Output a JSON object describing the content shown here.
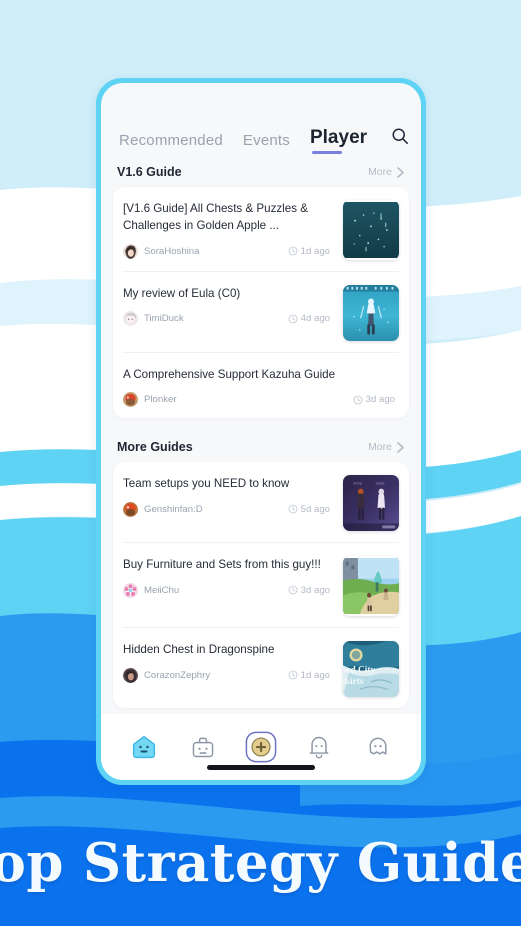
{
  "theme": {
    "page_bg": "#cfeefa",
    "frame_border": "#5fd3f3",
    "screen_bg": "#f7f8fa",
    "card_bg": "#ffffff",
    "accent_underline": "#7b7fe0",
    "banner_bg": "#0b72ee",
    "banner_text_color": "#f4fbff",
    "wave_light": "#ffffff",
    "wave_pale": "#cfeefa",
    "wave_cyan": "#5fd3f3",
    "wave_blue": "#2b9bf0",
    "wave_deep": "#0b72ee"
  },
  "tabs": [
    {
      "label": "Recommended",
      "active": false
    },
    {
      "label": "Events",
      "active": false
    },
    {
      "label": "Player",
      "active": true
    }
  ],
  "search": {
    "icon": "search-icon"
  },
  "sections": [
    {
      "title": "V1.6 Guide",
      "more_label": "More",
      "items": [
        {
          "title": "[V1.6 Guide] All Chests & Puzzles & Challenges in Golden Apple ...",
          "author": "SoraHoshina",
          "time": "1d ago",
          "thumb": "starry-night-chests"
        },
        {
          "title": "My review of Eula (C0)",
          "author": "TimiDuck",
          "time": "4d ago",
          "thumb": "eula-character"
        },
        {
          "title": "A Comprehensive Support Kazuha Guide",
          "author": "Plonker",
          "time": "3d ago",
          "thumb": ""
        }
      ]
    },
    {
      "title": "More Guides",
      "more_label": "More",
      "items": [
        {
          "title": "Team setups you NEED to know",
          "author": "Genshinfan:D",
          "time": "5d ago",
          "thumb": "two-characters-night"
        },
        {
          "title": "Buy Furniture and Sets from this guy!!!",
          "author": "MeiiChu",
          "time": "3d ago",
          "thumb": "village-daylight"
        },
        {
          "title": "Hidden Chest in Dragonspine",
          "author": "CorazonZephry",
          "time": "1d ago",
          "thumb": "map-city-outskirts"
        }
      ]
    }
  ],
  "bottom_nav": [
    {
      "name": "home-icon",
      "active": true
    },
    {
      "name": "toolbox-icon",
      "active": false
    },
    {
      "name": "add-post-icon",
      "active": false
    },
    {
      "name": "notifications-bell-icon",
      "active": false
    },
    {
      "name": "profile-ghost-icon",
      "active": false
    }
  ],
  "banner": {
    "headline": "Top Strategy Guides"
  }
}
